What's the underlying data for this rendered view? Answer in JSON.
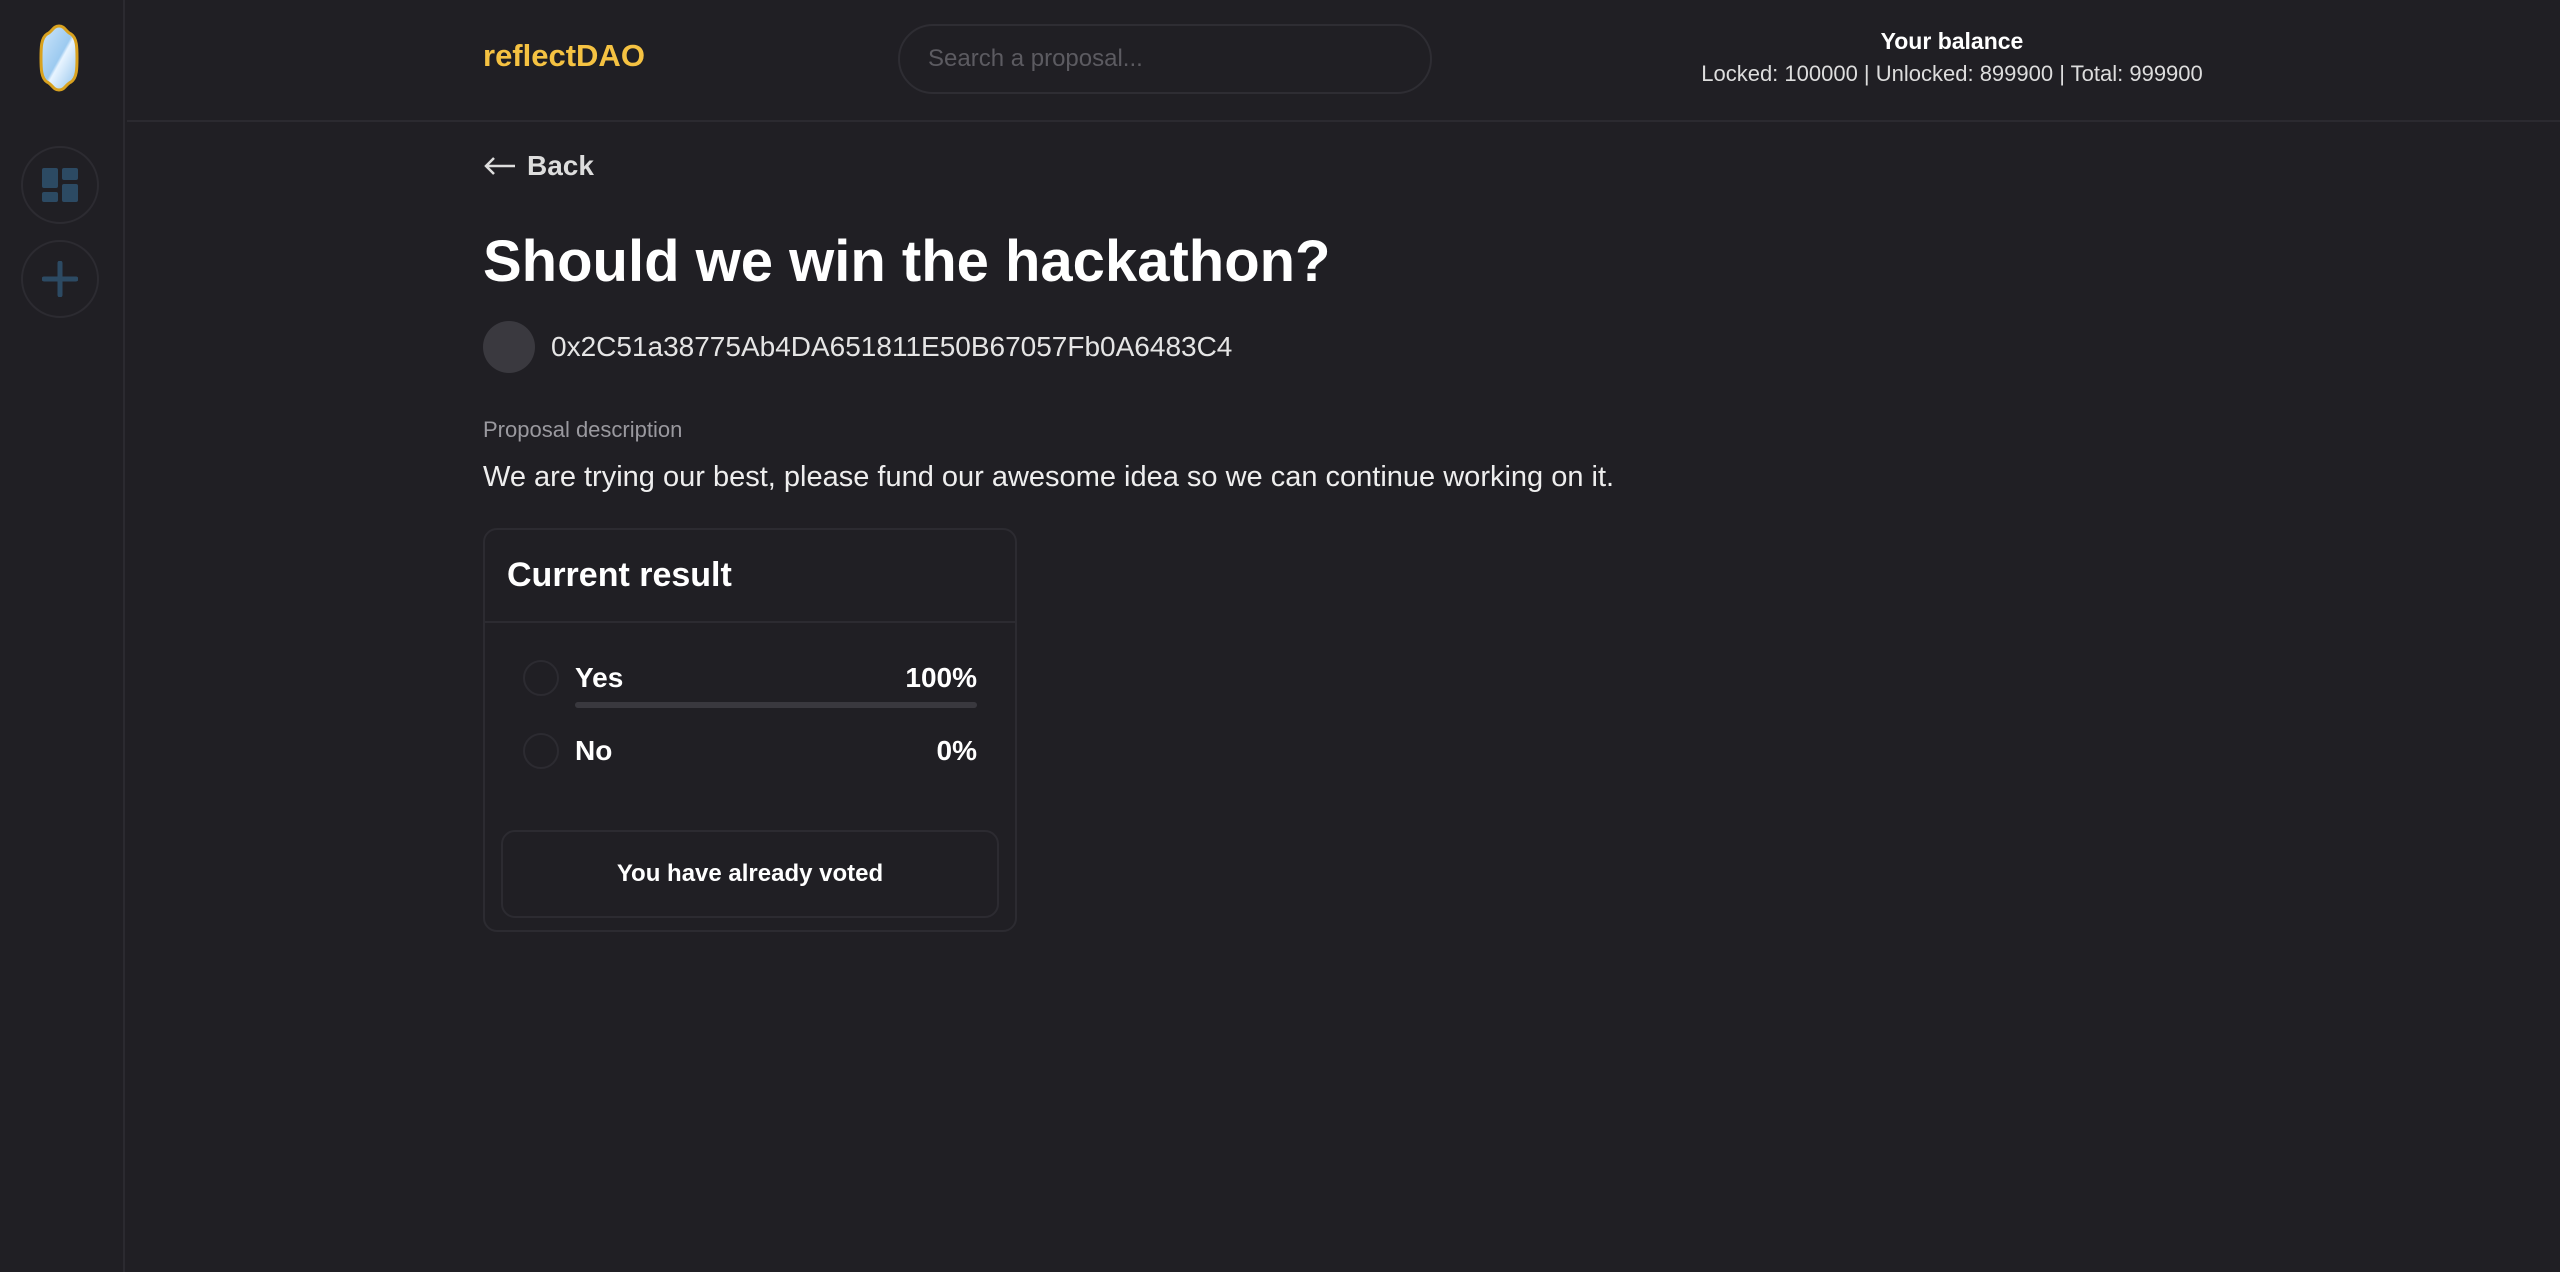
{
  "app": {
    "brand": "reflectDAO",
    "brand_color": "#f5c242"
  },
  "sidebar": {
    "items": [
      {
        "icon": "dashboard-icon"
      },
      {
        "icon": "plus-icon"
      }
    ]
  },
  "header": {
    "search_placeholder": "Search a proposal...",
    "balance": {
      "title": "Your balance",
      "line": "Locked: 100000 | Unlocked: 899900 | Total: 999900"
    }
  },
  "proposal": {
    "back_label": "Back",
    "title": "Should we win the hackathon?",
    "author": "0x2C51a38775Ab4DA651811E50B67057Fb0A6483C4",
    "description_label": "Proposal description",
    "description": "We are trying our best, please fund our awesome idea so we can continue working on it."
  },
  "result": {
    "title": "Current result",
    "options": [
      {
        "label": "Yes",
        "percent_label": "100%",
        "percent": 100
      },
      {
        "label": "No",
        "percent_label": "0%",
        "percent": 0
      }
    ],
    "status": "You have already voted"
  }
}
